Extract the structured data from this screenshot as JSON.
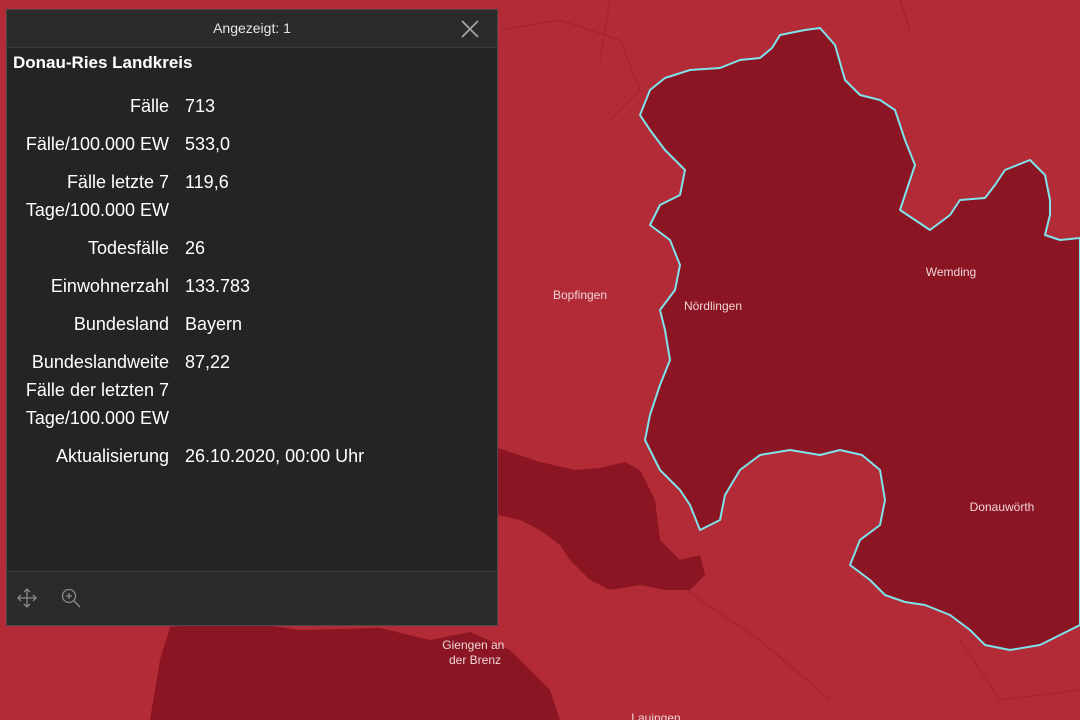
{
  "popup": {
    "header_title": "Angezeigt: 1",
    "feature_title": "Donau-Ries Landkreis",
    "attributes": [
      {
        "label": "Fälle",
        "value": "713"
      },
      {
        "label": "Fälle/100.000 EW",
        "value": "533,0"
      },
      {
        "label": "Fälle letzte 7 Tage/100.000 EW",
        "value": "119,6"
      },
      {
        "label": "Todesfälle",
        "value": "26"
      },
      {
        "label": "Einwohnerzahl",
        "value": "133.783"
      },
      {
        "label": "Bundesland",
        "value": "Bayern"
      },
      {
        "label": "Bundeslandweite Fälle der letzten 7 Tage/100.000 EW",
        "value": "87,22"
      },
      {
        "label": "Aktualisierung",
        "value": "26.10.2020, 00:00 Uhr"
      }
    ],
    "footer_icons": [
      "pan-icon",
      "zoom-to-icon"
    ],
    "close_icon": "close-icon"
  },
  "map": {
    "places": [
      "Bopfingen",
      "Nördlingen",
      "Wemding",
      "Donauwörth",
      "Giengen an\nder Brenz",
      "Lauingen"
    ],
    "colors": {
      "background": "#b22b36",
      "dark_region": "#8b1522",
      "selected_outline": "#7fe3ec",
      "popup_background": "#242424"
    }
  }
}
